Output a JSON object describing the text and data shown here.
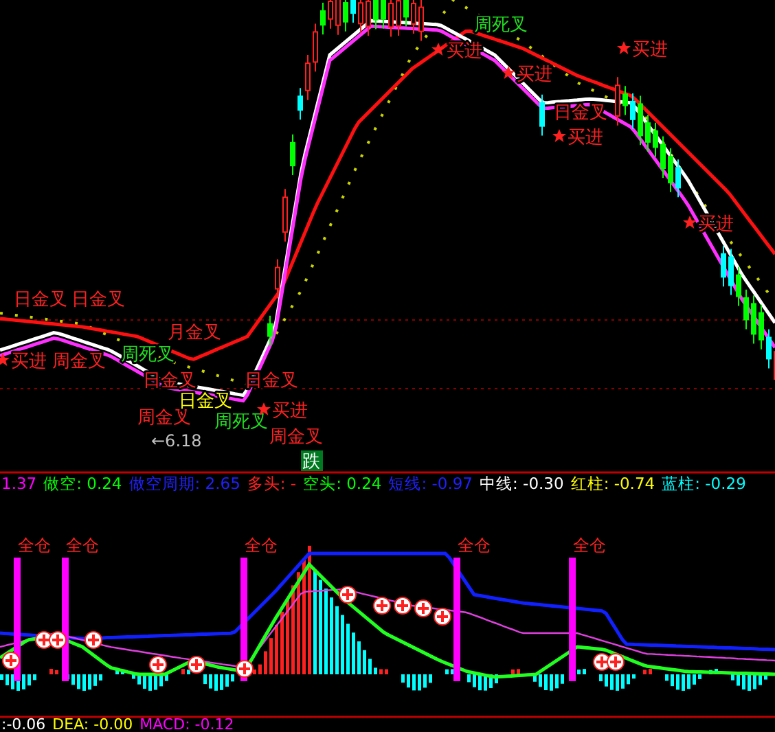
{
  "main_chart": {
    "signals": [
      {
        "text": "日金叉",
        "kind": "cross",
        "color": "#ff2020"
      },
      {
        "text": "日金叉",
        "kind": "cross",
        "color": "#ff2020"
      },
      {
        "text": "买进",
        "kind": "buy",
        "color": "#ff2020"
      },
      {
        "text": "周金叉",
        "kind": "cross",
        "color": "#ff2020"
      },
      {
        "text": "月金叉",
        "kind": "cross",
        "color": "#ff2020"
      },
      {
        "text": "周死叉",
        "kind": "cross",
        "color": "#20e020"
      },
      {
        "text": "日金叉",
        "kind": "cross",
        "color": "#ff2020"
      },
      {
        "text": "周金叉",
        "kind": "cross",
        "color": "#ff2020"
      },
      {
        "text": "日金叉",
        "kind": "cross",
        "color": "#ffff00"
      },
      {
        "text": "周死叉",
        "kind": "cross",
        "color": "#20e020"
      },
      {
        "text": "日金叉",
        "kind": "cross",
        "color": "#ff2020"
      },
      {
        "text": "买进",
        "kind": "buy",
        "color": "#ff2020"
      },
      {
        "text": "周金叉",
        "kind": "cross",
        "color": "#ff2020"
      },
      {
        "text": "周死叉",
        "kind": "cross",
        "color": "#20e020"
      },
      {
        "text": "买进",
        "kind": "buy",
        "color": "#ff2020"
      },
      {
        "text": "买进",
        "kind": "buy",
        "color": "#ff2020"
      },
      {
        "text": "买进",
        "kind": "buy",
        "color": "#ff2020"
      },
      {
        "text": "日金叉",
        "kind": "cross",
        "color": "#ff2020"
      },
      {
        "text": "买进",
        "kind": "buy",
        "color": "#ff2020"
      },
      {
        "text": "买进",
        "kind": "buy",
        "color": "#ff2020"
      }
    ],
    "low_marker": "←6.18",
    "trend_badge": "跌"
  },
  "indicator_readout": [
    {
      "text": "1.37",
      "color": "#ff00ff"
    },
    {
      "text": "做空: 0.24",
      "color": "#00ff00"
    },
    {
      "text": "做空周期: 2.65",
      "color": "#2020ff"
    },
    {
      "text": "多头: -",
      "color": "#ff2020"
    },
    {
      "text": "空头: 0.24",
      "color": "#00ff00"
    },
    {
      "text": "短线: -0.97",
      "color": "#2020ff"
    },
    {
      "text": "中线: -0.30",
      "color": "#ffffff"
    },
    {
      "text": "红柱: -0.74",
      "color": "#ffff00"
    },
    {
      "text": "蓝柱: -0.29",
      "color": "#00ffff"
    }
  ],
  "lower_chart": {
    "signals": [
      "全仓",
      "全仓",
      "全仓",
      "全仓",
      "全仓"
    ]
  },
  "macd_readout": [
    {
      "text": ":-0.06",
      "color": "#ffffff"
    },
    {
      "text": "DEA: -0.00",
      "color": "#ffff00"
    },
    {
      "text": "MACD: -0.12",
      "color": "#ff00ff"
    }
  ]
}
